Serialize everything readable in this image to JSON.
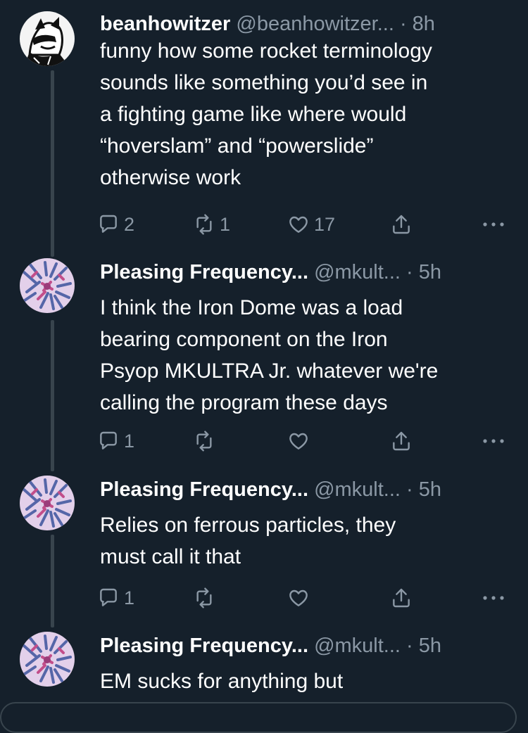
{
  "tweets": [
    {
      "name": "beanhowitzer",
      "handle": "@beanhowitzer...",
      "time": "· 8h",
      "lines": [
        "funny how some rocket terminology",
        "sounds like something you’d see in",
        "a fighting game like where would",
        "“hoverslam” and “powerslide”",
        "otherwise work"
      ],
      "reply_count": "2",
      "retweet_count": "1",
      "like_count": "17",
      "avatar": "anime-character-avatar"
    },
    {
      "name": "Pleasing Frequency...",
      "handle": "@mkult...",
      "time": "· 5h",
      "lines": [
        "I think the Iron Dome was a load",
        "bearing component on the Iron",
        "Psyop MKULTRA Jr. whatever we're",
        "calling the program these days"
      ],
      "reply_count": "1",
      "retweet_count": "",
      "like_count": "",
      "avatar": "pattern-avatar"
    },
    {
      "name": "Pleasing Frequency...",
      "handle": "@mkult...",
      "time": "· 5h",
      "lines": [
        "Relies on ferrous particles, they",
        "must call it that"
      ],
      "reply_count": "1",
      "retweet_count": "",
      "like_count": "",
      "avatar": "pattern-avatar"
    },
    {
      "name": "Pleasing Frequency...",
      "handle": "@mkult...",
      "time": "· 5h",
      "lines": [
        "EM sucks for anything but"
      ],
      "avatar": "pattern-avatar"
    }
  ],
  "icons": {
    "reply": "reply-icon",
    "retweet": "retweet-icon",
    "like": "heart-icon",
    "share": "share-icon",
    "more": "more-icon"
  },
  "colors": {
    "background": "#15202b",
    "text": "#ffffff",
    "secondary": "#8b98a5",
    "thread_line": "#38444d"
  }
}
